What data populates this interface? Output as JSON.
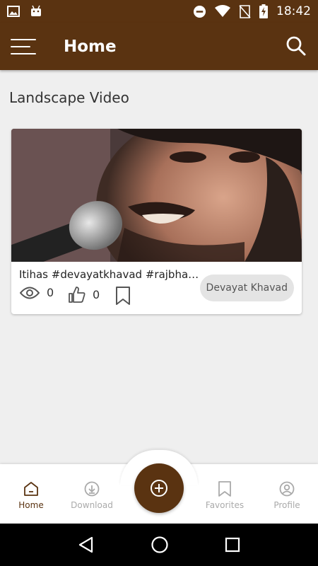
{
  "status_bar": {
    "time": "18:42",
    "icons": [
      "image-icon",
      "android-icon",
      "dnd-icon",
      "wifi-icon",
      "no-sim-icon",
      "battery-charging-icon"
    ]
  },
  "app_bar": {
    "title": "Home",
    "menu_icon": "hamburger-menu-icon",
    "search_icon": "search-icon"
  },
  "section": {
    "title": "Landscape Video"
  },
  "video": {
    "title": "Itihas #devayatkhavad #rajbha…",
    "views": "0",
    "likes": "0",
    "channel": "Devayat Khavad"
  },
  "bottom_nav": {
    "items": [
      {
        "label": "Home",
        "icon": "home-icon",
        "active": true
      },
      {
        "label": "Download",
        "icon": "download-icon",
        "active": false
      },
      {
        "label": "Favorites",
        "icon": "bookmark-icon",
        "active": false
      },
      {
        "label": "Profile",
        "icon": "profile-icon",
        "active": false
      }
    ],
    "fab_icon": "add-circle-icon"
  },
  "colors": {
    "primary": "#5a3311",
    "background": "#efefef",
    "chip": "#e4e4e4"
  }
}
